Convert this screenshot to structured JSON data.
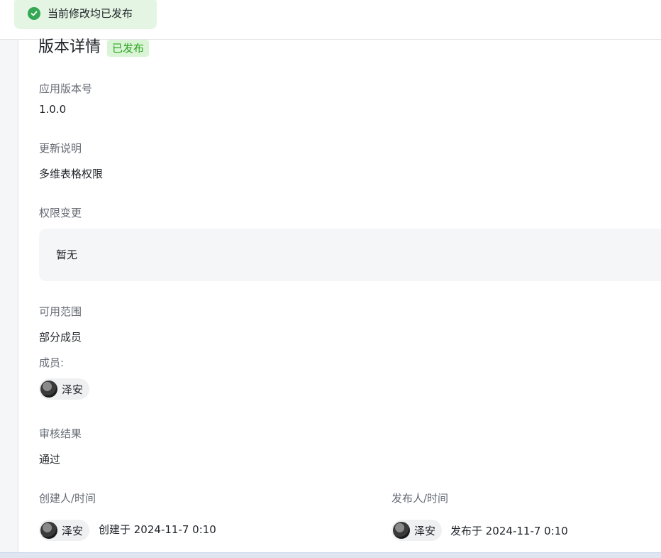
{
  "toast": {
    "text": "当前修改均已发布",
    "icon": "check-circle-icon",
    "color": "#34a853"
  },
  "detail": {
    "title": "版本详情",
    "status_tag": "已发布",
    "version_label": "应用版本号",
    "version_value": "1.0.0",
    "notes_label": "更新说明",
    "notes_value": "多维表格权限",
    "permission_label": "权限变更",
    "permission_value": "暂无",
    "scope_label": "可用范围",
    "scope_value": "部分成员",
    "members_label": "成员:",
    "members": [
      {
        "name": "泽安"
      }
    ],
    "review_label": "审核结果",
    "review_value": "通过",
    "creator_label": "创建人/时间",
    "creator_name": "泽安",
    "created_text": "创建于 2024-11-7 0:10",
    "publisher_label": "发布人/时间",
    "publisher_name": "泽安",
    "published_text": "发布于 2024-11-7 0:10"
  }
}
